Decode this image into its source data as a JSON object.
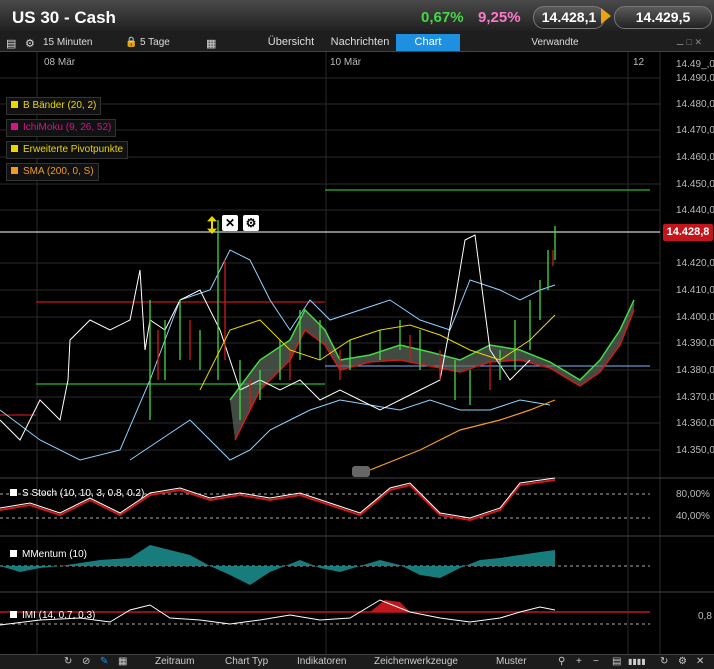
{
  "header": {
    "title": "US 30 - Cash",
    "change_abs": "0,67%",
    "change_pct": "9,25%",
    "bid": "14.428,1",
    "ask": "14.429,5"
  },
  "toolbar": {
    "interval": "15 Minuten",
    "range": "5 Tage",
    "tabs": [
      "Übersicht",
      "Nachrichten",
      "Chart",
      "Verwandte"
    ],
    "active_tab": "Chart"
  },
  "chart": {
    "x_labels": [
      "08 Mär",
      "10 Mär",
      "12"
    ],
    "y_labels": [
      "14.490,0",
      "14.480,0",
      "14.470,0",
      "14.460,0",
      "14.450,0",
      "14.440,0",
      "14.420,0",
      "14.410,0",
      "14.400,0",
      "14.390,0",
      "14.380,0",
      "14.370,0",
      "14.360,0",
      "14.350,0"
    ],
    "top_y_label": "14.49_,0",
    "current_price": "14.428,8",
    "indicators": [
      {
        "label": "B Bänder (20, 2)",
        "color": "#e8d800"
      },
      {
        "label": "IchiMoku (9, 26, 52)",
        "color": "#d2158a"
      },
      {
        "label": "Erweiterte Pivotpunkte",
        "color": "#e8d800"
      },
      {
        "label": "SMA (200, 0, S)",
        "color": "#f39a1d"
      }
    ]
  },
  "subcharts": {
    "stoch": {
      "label": "S Stoch (10, 10, 3, 0.8, 0.2)",
      "y1": "80,00%",
      "y2": "40,00%"
    },
    "momentum": {
      "label": "MMentum (10)"
    },
    "imi": {
      "label": "IMI (14, 0.7, 0.3)",
      "y1": "0,8"
    }
  },
  "bottom": {
    "items": [
      "Zeitraum",
      "Chart Typ",
      "Indikatoren",
      "Zeichenwerkzeuge",
      "Muster"
    ]
  },
  "colors": {
    "accent_tab": "#1f8fe0",
    "up": "#44d944",
    "down": "#d01a1a",
    "price_tag": "#c0161c"
  }
}
